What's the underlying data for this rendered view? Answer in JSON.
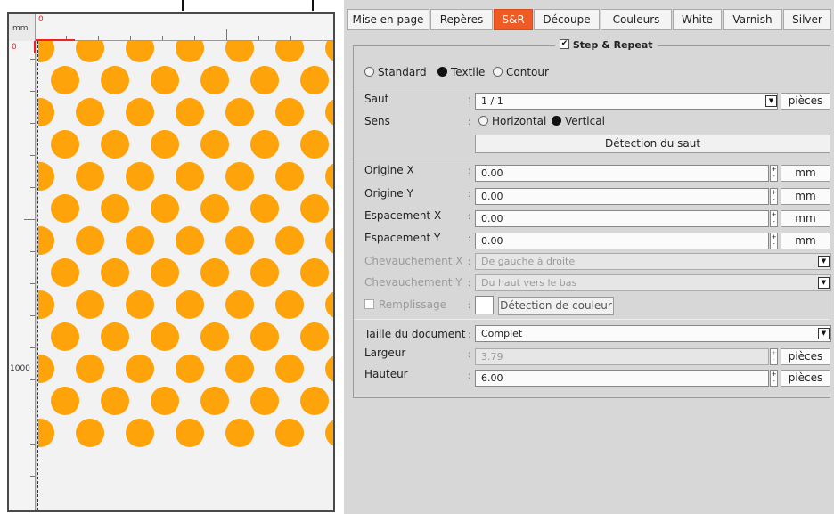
{
  "ruler": {
    "unit": "mm",
    "h_zero": "0",
    "v_zero": "0",
    "v_1000": "1000"
  },
  "preview": {
    "pattern_color": "#ffa30a",
    "background_color": "#f2f2f2",
    "pattern": "polka-dots"
  },
  "tabs": [
    {
      "label": "Mise en page",
      "active": false
    },
    {
      "label": "Repères",
      "active": false
    },
    {
      "label": "S&R",
      "active": true
    },
    {
      "label": "Découpe",
      "active": false
    },
    {
      "label": "Couleurs",
      "active": false
    },
    {
      "label": "White",
      "active": false
    },
    {
      "label": "Varnish",
      "active": false
    },
    {
      "label": "Silver",
      "active": false
    }
  ],
  "accent_color": "#f05a24",
  "group": {
    "title": "Step & Repeat",
    "checked": true
  },
  "mode": {
    "standard": "Standard",
    "textile": "Textile",
    "contour": "Contour",
    "selected": "Textile"
  },
  "saut": {
    "label": "Saut",
    "value": "1 / 1",
    "unit": "pièces"
  },
  "sens": {
    "label": "Sens",
    "horizontal": "Horizontal",
    "vertical": "Vertical",
    "selected": "Vertical"
  },
  "detect_jump_button": "Détection du saut",
  "origin_x": {
    "label": "Origine X",
    "value": "0.00",
    "unit": "mm"
  },
  "origin_y": {
    "label": "Origine Y",
    "value": "0.00",
    "unit": "mm"
  },
  "spacing_x": {
    "label": "Espacement X",
    "value": "0.00",
    "unit": "mm"
  },
  "spacing_y": {
    "label": "Espacement Y",
    "value": "0.00",
    "unit": "mm"
  },
  "overlap_x": {
    "label": "Chevauchement X",
    "value": "De gauche à droite"
  },
  "overlap_y": {
    "label": "Chevauchement Y",
    "value": "Du haut vers le bas"
  },
  "fill": {
    "label": "Remplissage",
    "checked": false,
    "swatch_color": "#ffffff",
    "detect_color_button": "Détection de couleur"
  },
  "doc_size": {
    "label": "Taille du document",
    "value": "Complet"
  },
  "width": {
    "label": "Largeur",
    "value": "3.79",
    "unit": "pièces"
  },
  "height": {
    "label": "Hauteur",
    "value": "6.00",
    "unit": "pièces"
  }
}
